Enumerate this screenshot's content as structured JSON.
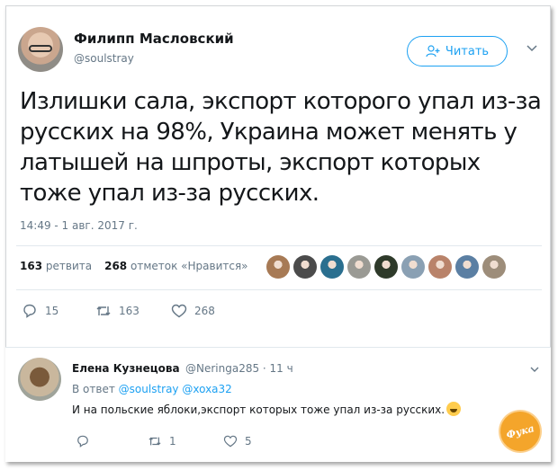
{
  "tweet": {
    "author_name": "Филипп Масловский",
    "author_handle": "@soulstray",
    "follow_label": "Читать",
    "text": "Излишки сала, экспорт которого упал из-за русских на 98%, Украина может менять у латышей на шпроты, экспорт которых тоже упал из-за русских.",
    "timestamp": "14:49 - 1 авг. 2017 г.",
    "retweet_count": "163",
    "retweet_label": "ретвита",
    "like_count": "268",
    "like_label": "отметок «Нравится»",
    "actions": {
      "reply_count": "15",
      "retweet_count": "163",
      "like_count": "268"
    },
    "liker_colors": [
      "#a77a55",
      "#4b4b4b",
      "#2a6f8f",
      "#9a9a94",
      "#2e3a2a",
      "#8aa0b3",
      "#b9836a",
      "#5b7fa3",
      "#9d8d7a"
    ]
  },
  "reply": {
    "author_name": "Елена Кузнецова",
    "author_handle": "@Neringa285 · 11 ч",
    "reply_to_prefix": "В ответ",
    "reply_to_1": "@soulstray",
    "reply_to_2": "@xoxa32",
    "text": "И на польские яблоки,экспорт которых тоже упал из-за русских.",
    "actions": {
      "retweet_count": "1",
      "like_count": "5"
    }
  },
  "watermark_text": "Фука",
  "colors": {
    "accent": "#1da1f2",
    "muted": "#657786",
    "text": "#14171a"
  }
}
